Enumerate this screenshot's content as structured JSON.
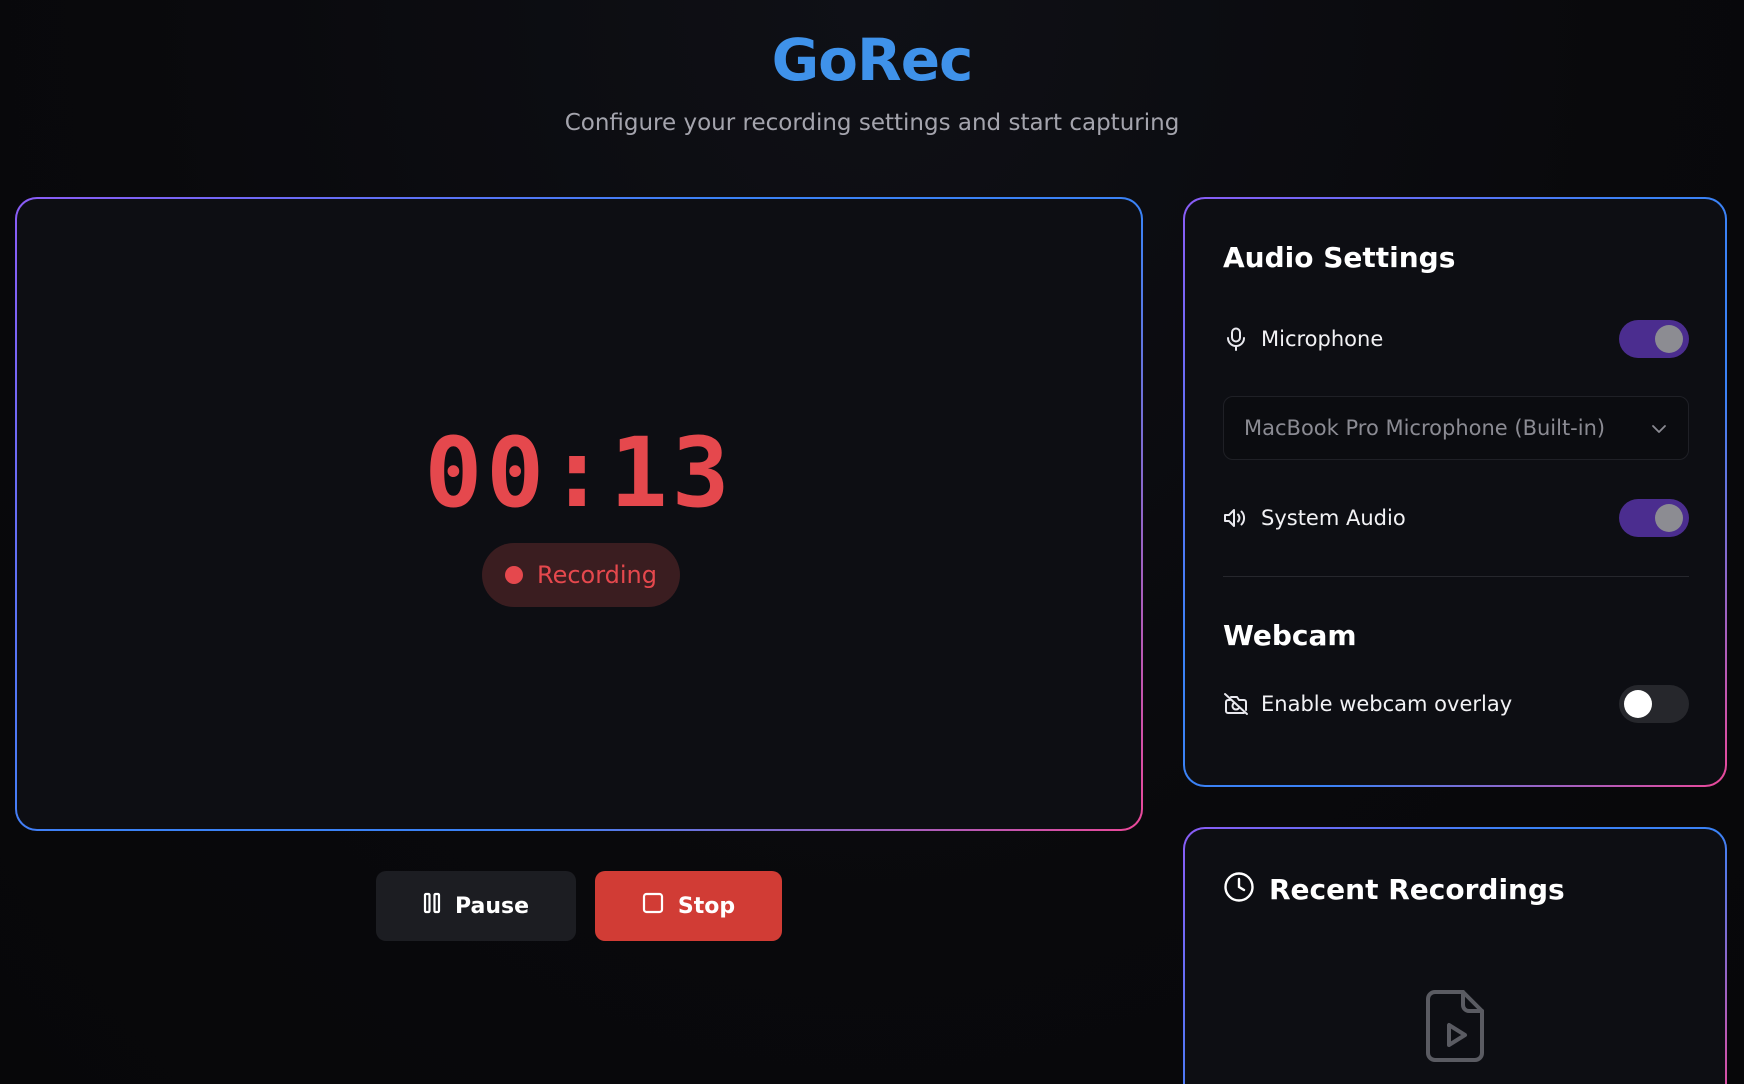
{
  "header": {
    "title": "GoRec",
    "subtitle": "Configure your recording settings and start capturing"
  },
  "preview": {
    "timer": "00:13",
    "status": "Recording"
  },
  "controls": {
    "pause_label": "Pause",
    "stop_label": "Stop"
  },
  "audio": {
    "title": "Audio Settings",
    "microphone": {
      "label": "Microphone",
      "enabled": true,
      "device": "MacBook Pro Microphone (Built-in)"
    },
    "system_audio": {
      "label": "System Audio",
      "enabled": true
    }
  },
  "webcam": {
    "title": "Webcam",
    "overlay": {
      "label": "Enable webcam overlay",
      "enabled": false
    }
  },
  "recent": {
    "title": "Recent Recordings"
  },
  "icons": {
    "pause": "pause-icon",
    "stop": "stop-icon",
    "microphone": "microphone-icon",
    "speaker": "speaker-icon",
    "camera_off": "camera-off-icon",
    "clock": "clock-icon",
    "video_file": "video-file-icon",
    "chevron": "chevron-down-icon"
  },
  "colors": {
    "brand": "#3f92ea",
    "recording": "#e5484d",
    "stop_button": "#d13c35",
    "toggle_on": "#4b2d8f"
  }
}
